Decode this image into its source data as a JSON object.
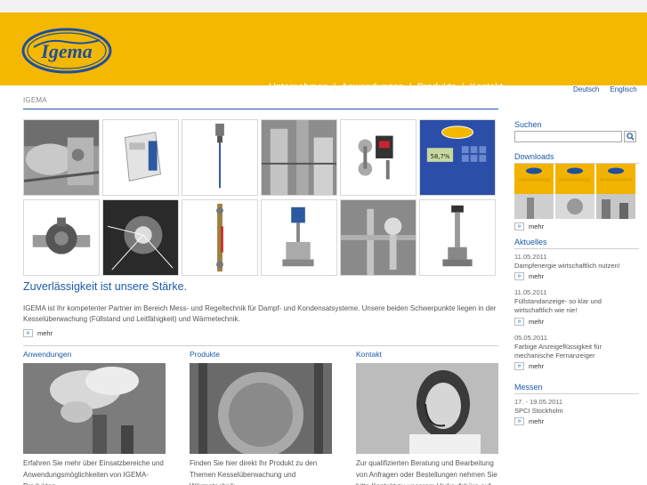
{
  "header": {
    "logo_text": "IGEMA",
    "nav": [
      "Unternehmen",
      "Anwendungen",
      "Produkte",
      "Kontakt"
    ],
    "lang": [
      "Deutsch",
      "Englisch"
    ]
  },
  "breadcrumb": "IGEMA",
  "main": {
    "display_tile_value": "58,7%",
    "headline": "Zuverlässigkeit ist unsere Stärke.",
    "intro": "IGEMA ist Ihr kompetenter Partner im Bereich Mess- und Regeltechnik für Dampf- und Kondensatsysteme. Unsere beiden Schwerpunkte liegen in der Kesselüberwachung (Füllstand und Leitfähigkeit) und Wärmetechnik.",
    "mehr": "mehr",
    "columns": [
      {
        "title": "Anwendungen",
        "text": "Erfahren Sie mehr über Einsatzbereiche und Anwendungsmöglichkeiten von IGEMA-Produkten"
      },
      {
        "title": "Produkte",
        "text": "Finden Sie hier direkt Ihr Produkt zu den Themen Kesselüberwachung und Wärmetechnik"
      },
      {
        "title": "Kontakt",
        "text": "Zur qualifizierten Beratung und Bearbeitung von Anfragen oder Bestellungen nehmen Sie bitte Kontakt zu unserem Verkaufsbüro auf"
      }
    ]
  },
  "sidebar": {
    "search_title": "Suchen",
    "search_value": "",
    "downloads_title": "Downloads",
    "mehr": "mehr",
    "news_title": "Aktuelles",
    "news": [
      {
        "date": "11.05.2011",
        "text": "Dampfenergie wirtschaftlich nutzen!"
      },
      {
        "date": "11.05.2011",
        "text": "Füllstandanzeige- so klar und wirtschaftlich wie nie!"
      },
      {
        "date": "05.05.2011",
        "text": "Farbige Anzeigeflüssigkeit für mechanische Fernanzeiger"
      }
    ],
    "fairs_title": "Messen",
    "fairs": [
      {
        "date": "17. - 19.05.2011",
        "text": "SPCI Stockholm"
      }
    ]
  },
  "colors": {
    "header_bg": "#f5b800",
    "accent_blue": "#1e5aa8",
    "logo_blue": "#1d4fa0"
  }
}
